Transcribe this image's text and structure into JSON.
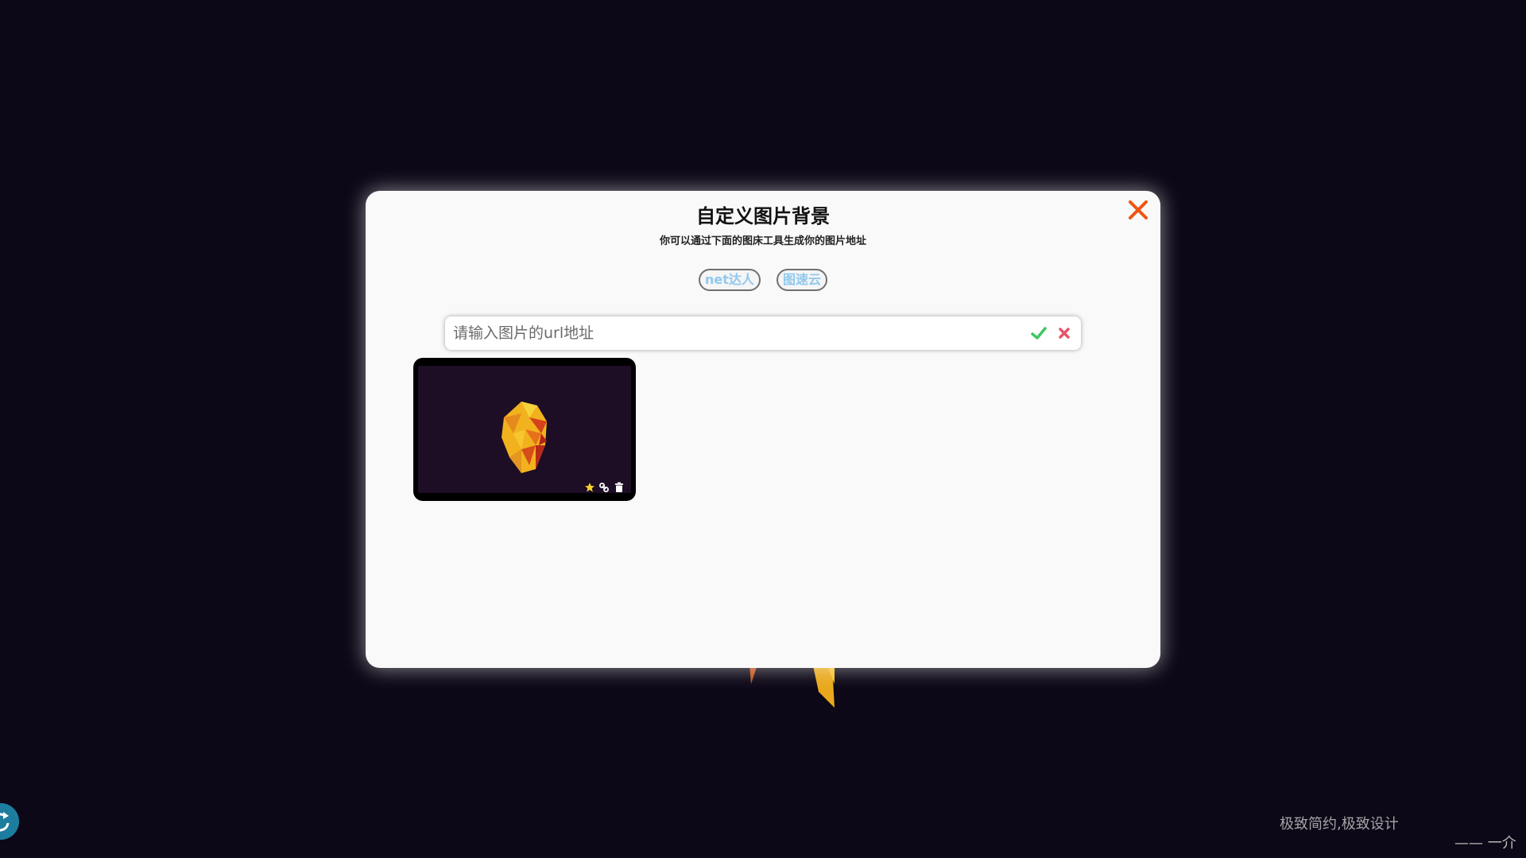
{
  "modal": {
    "title": "自定义图片背景",
    "subtitle": "你可以通过下面的图床工具生成你的图片地址",
    "links": [
      {
        "label": "net达人"
      },
      {
        "label": "图速云"
      }
    ],
    "url_input": {
      "value": "",
      "placeholder": "请输入图片的url地址"
    },
    "thumbnail": {
      "icons": [
        "star-icon",
        "link-icon",
        "trash-icon"
      ]
    }
  },
  "footer": {
    "slogan": "极致简约,极致设计",
    "signature": "—— 一介"
  },
  "colors": {
    "page_bg": "#0d0817",
    "modal_bg": "#f9f9f9",
    "close": "#f0550f",
    "link_text": "#8fc8ee",
    "confirm": "#3ec85c",
    "cancel": "#e9546b",
    "star": "#f7d22c"
  }
}
